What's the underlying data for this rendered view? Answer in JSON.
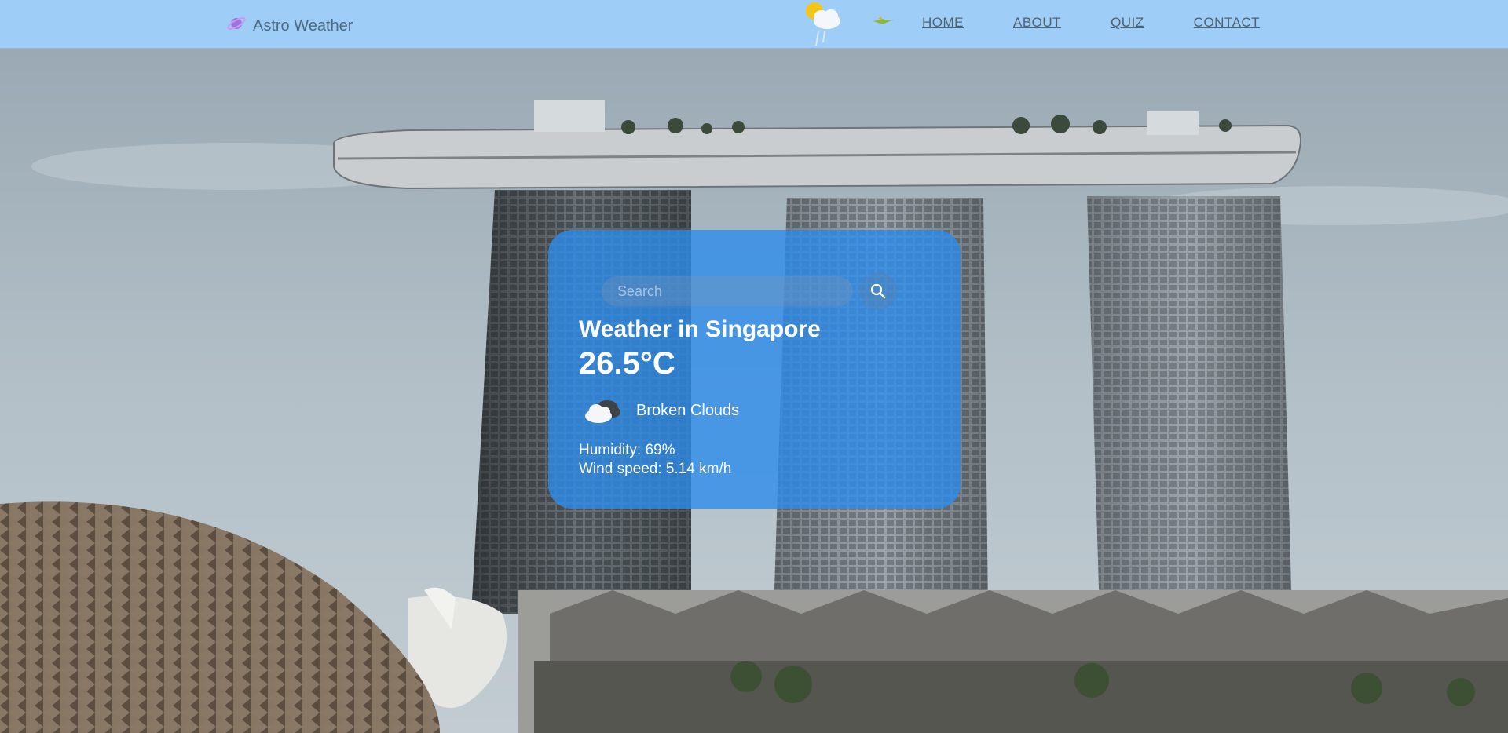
{
  "header": {
    "brand_name": "Astro Weather",
    "nav": {
      "home": "HOME",
      "about": "ABOUT",
      "quiz": "QUIZ",
      "contact": "CONTACT"
    },
    "icons": [
      "planet-logo-icon",
      "sun-cloud-rain-icon",
      "plane-icon"
    ]
  },
  "weather_card": {
    "search": {
      "placeholder": "Search",
      "value": ""
    },
    "search_icon": "magnifier-icon",
    "title": "Weather in Singapore",
    "temperature": "26.5°C",
    "condition_icon": "broken-clouds-icon",
    "condition": "Broken Clouds",
    "humidity": "Humidity: 69%",
    "wind": "Wind speed: 5.14 km/h"
  },
  "colors": {
    "header_bg": "#9ecdf7",
    "card_bg": "#2d8ceb",
    "text_light": "#ffffff",
    "nav_text": "#4f6270"
  }
}
